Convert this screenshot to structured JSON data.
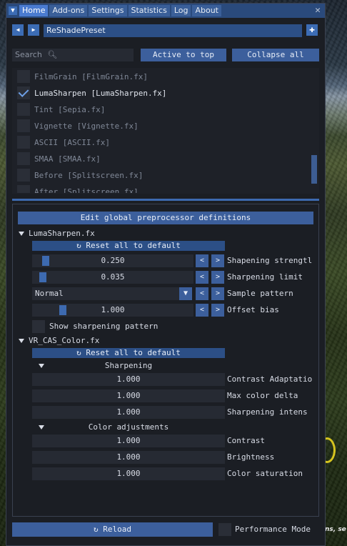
{
  "tabs": [
    "Home",
    "Add-ons",
    "Settings",
    "Statistics",
    "Log",
    "About"
  ],
  "active_tab": "Home",
  "preset": {
    "name": "ReShadePreset"
  },
  "search": {
    "placeholder": "Search"
  },
  "toolbar": {
    "active_to_top": "Active to top",
    "collapse_all": "Collapse all"
  },
  "effects": [
    {
      "label": "FilmGrain [FilmGrain.fx]",
      "checked": false
    },
    {
      "label": "LumaSharpen [LumaSharpen.fx]",
      "checked": true
    },
    {
      "label": "Tint [Sepia.fx]",
      "checked": false
    },
    {
      "label": "Vignette [Vignette.fx]",
      "checked": false
    },
    {
      "label": "ASCII [ASCII.fx]",
      "checked": false
    },
    {
      "label": "SMAA [SMAA.fx]",
      "checked": false
    },
    {
      "label": "Before [Splitscreen.fx]",
      "checked": false
    },
    {
      "label": "After [Splitscreen.fx]",
      "checked": false
    }
  ],
  "settings": {
    "edit_defs": "Edit global preprocessor definitions",
    "luma": {
      "title": "LumaSharpen.fx",
      "reset": "Reset all to default",
      "strength": {
        "value": "0.250",
        "label": "Shapening strengtl"
      },
      "limit": {
        "value": "0.035",
        "label": "Sharpening limit"
      },
      "pattern": {
        "value": "Normal",
        "label": "Sample pattern"
      },
      "offset": {
        "value": "1.000",
        "label": "Offset bias"
      },
      "show": {
        "label": "Show sharpening pattern"
      }
    },
    "cas": {
      "title": "VR_CAS_Color.fx",
      "reset": "Reset all to default",
      "sharpening": "Sharpening",
      "contrast_adapt": {
        "value": "1.000",
        "label": "Contrast Adaptatio"
      },
      "max_delta": {
        "value": "1.000",
        "label": "Max color delta"
      },
      "sharp_intens": {
        "value": "1.000",
        "label": "Sharpening intens"
      },
      "color_adj": "Color adjustments",
      "contrast": {
        "value": "1.000",
        "label": "Contrast"
      },
      "brightness": {
        "value": "1.000",
        "label": "Brightness"
      },
      "saturation": {
        "value": "1.000",
        "label": "Color saturation"
      }
    }
  },
  "bottom": {
    "reload": "Reload",
    "perf_mode": "Performance Mode"
  },
  "background_text": "ns, se"
}
